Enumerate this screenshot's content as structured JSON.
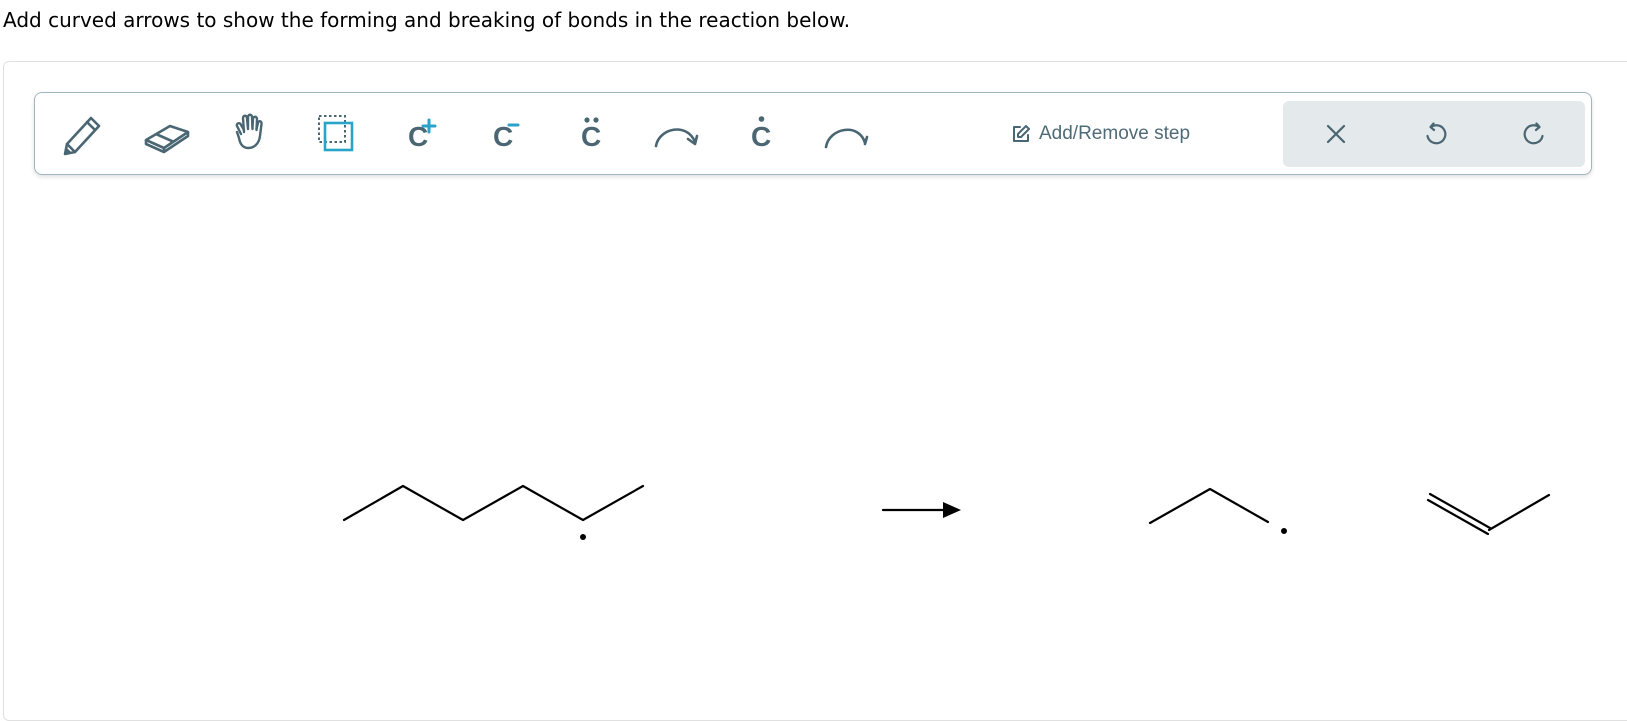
{
  "prompt": {
    "text": "Add curved arrows to show the forming and breaking of bonds in the reaction below."
  },
  "toolbar": {
    "tools": [
      {
        "icon": "pencil-icon"
      },
      {
        "icon": "eraser-icon"
      },
      {
        "icon": "hand-icon"
      },
      {
        "icon": "select-icon"
      },
      {
        "icon": "carbocation-icon",
        "glyph": "C",
        "sup": "+"
      },
      {
        "icon": "carbanion-icon",
        "glyph": "C",
        "sup": "−"
      },
      {
        "icon": "lone-pair-icon",
        "glyph": "C"
      },
      {
        "icon": "curved-arrow-icon"
      },
      {
        "icon": "radical-icon",
        "glyph": "C"
      },
      {
        "icon": "half-arrow-icon"
      }
    ],
    "step_label": "Add/Remove step",
    "actions": [
      {
        "icon": "close-icon"
      },
      {
        "icon": "undo-icon"
      },
      {
        "icon": "redo-icon"
      }
    ]
  },
  "colors": {
    "icon": "#4a6672",
    "accent": "#29a3c8",
    "toolbar_border": "#9fb6c0",
    "action_bg": "#e4e9ec",
    "bond": "#000000"
  }
}
